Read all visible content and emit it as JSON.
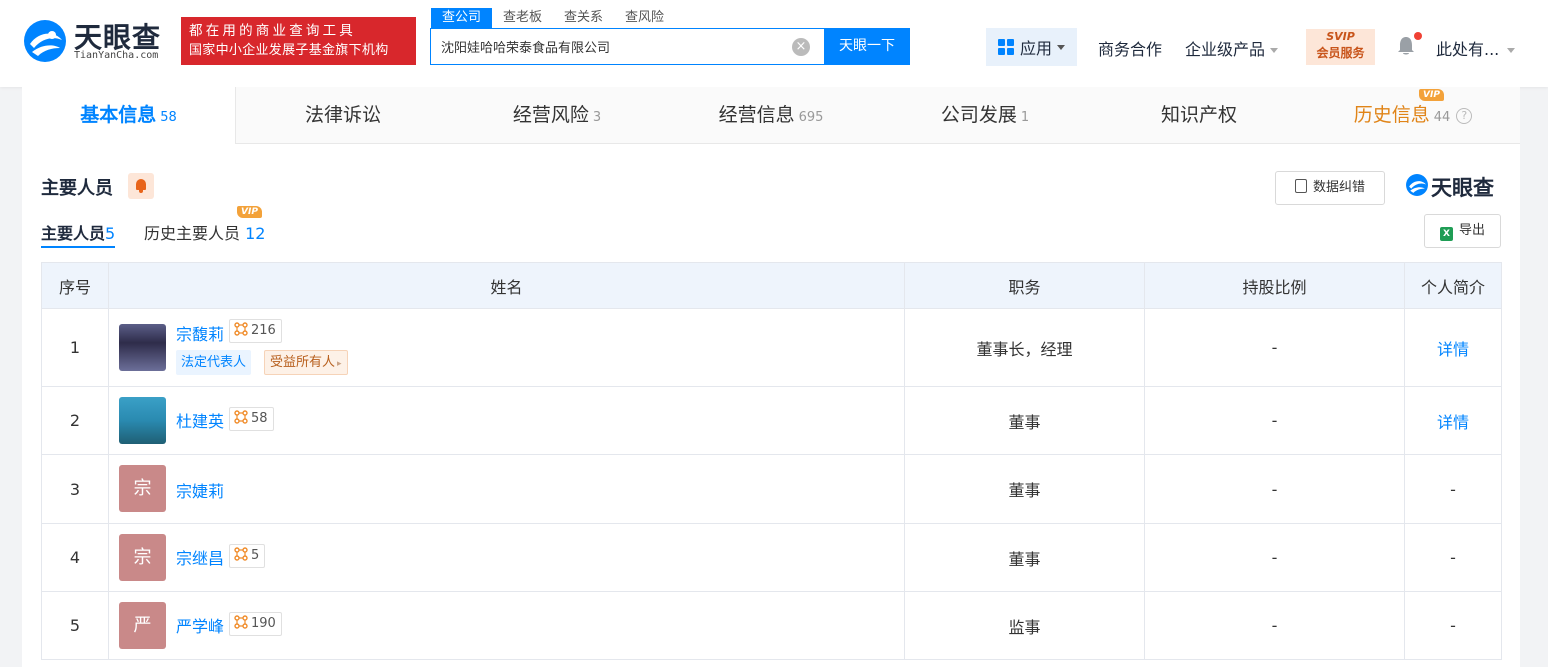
{
  "header": {
    "logo_text": "天眼查",
    "logo_sub": "TianYanCha.com",
    "slogan_line1": "都在用的商业查询工具",
    "slogan_line2": "国家中小企业发展子基金旗下机构",
    "search_tabs": [
      "查公司",
      "查老板",
      "查关系",
      "查风险"
    ],
    "search_value": "沈阳娃哈哈荣泰食品有限公司",
    "search_button": "天眼一下",
    "app_label": "应用",
    "nav_business": "商务合作",
    "nav_enterprise": "企业级产品",
    "svip_line1": "SVIP",
    "svip_line2": "会员服务",
    "user_name": "此处有..."
  },
  "tabs": [
    {
      "label": "基本信息",
      "count": "58"
    },
    {
      "label": "法律诉讼",
      "count": ""
    },
    {
      "label": "经营风险",
      "count": "3"
    },
    {
      "label": "经营信息",
      "count": "695"
    },
    {
      "label": "公司发展",
      "count": "1"
    },
    {
      "label": "知识产权",
      "count": ""
    },
    {
      "label": "历史信息",
      "count": "44"
    }
  ],
  "vip_tag": "VIP",
  "section": {
    "title": "主要人员",
    "correct_button": "数据纠错",
    "brand": "天眼查",
    "subtab_main_label": "主要人员",
    "subtab_main_count": "5",
    "subtab_hist_label": "历史主要人员",
    "subtab_hist_count": "12",
    "export_button": "导出"
  },
  "table": {
    "headers": [
      "序号",
      "姓名",
      "职务",
      "持股比例",
      "个人简介"
    ],
    "rows": [
      {
        "idx": "1",
        "name": "宗馥莉",
        "avatar_char": "",
        "rel": "216",
        "tags": [
          "法定代表人",
          "受益所有人"
        ],
        "position": "董事长，经理",
        "share": "-",
        "bio": "详情"
      },
      {
        "idx": "2",
        "name": "杜建英",
        "avatar_char": "",
        "rel": "58",
        "tags": [],
        "position": "董事",
        "share": "-",
        "bio": "详情"
      },
      {
        "idx": "3",
        "name": "宗婕莉",
        "avatar_char": "宗",
        "rel": "",
        "tags": [],
        "position": "董事",
        "share": "-",
        "bio": "-"
      },
      {
        "idx": "4",
        "name": "宗继昌",
        "avatar_char": "宗",
        "rel": "5",
        "tags": [],
        "position": "董事",
        "share": "-",
        "bio": "-"
      },
      {
        "idx": "5",
        "name": "严学峰",
        "avatar_char": "严",
        "rel": "190",
        "tags": [],
        "position": "监事",
        "share": "-",
        "bio": "-"
      }
    ]
  },
  "colors": {
    "brand_blue": "#0084ff",
    "slogan_red": "#d8272c",
    "vip_orange": "#f3a23a"
  }
}
